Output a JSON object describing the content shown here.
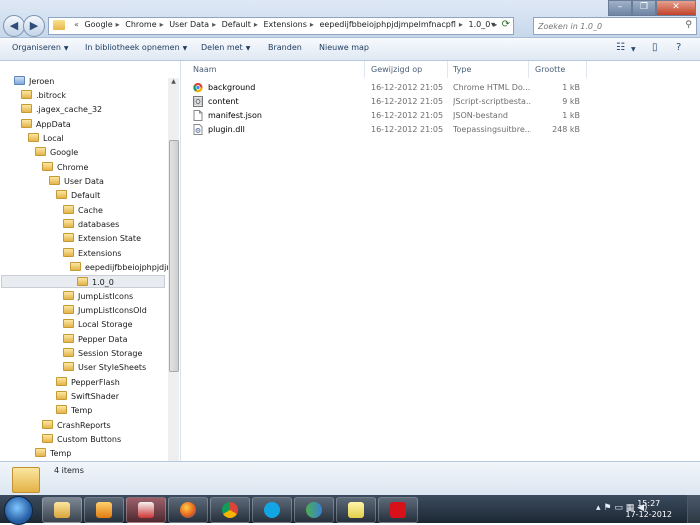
{
  "address": {
    "crumbs": [
      "Google",
      "Chrome",
      "User Data",
      "Default",
      "Extensions",
      "eepedijfbbeiojphpjdjmpelmfnacpfl",
      "1.0_0"
    ]
  },
  "search": {
    "placeholder": "Zoeken in 1.0_0"
  },
  "toolbar": {
    "organize": "Organiseren",
    "include_library": "In bibliotheek opnemen",
    "share": "Delen met",
    "burn": "Branden",
    "new_folder": "Nieuwe map"
  },
  "tree": [
    "Jeroen",
    ".bitrock",
    ".jagex_cache_32",
    "AppData",
    "Local",
    "Google",
    "Chrome",
    "User Data",
    "Default",
    "Cache",
    "databases",
    "Extension State",
    "Extensions",
    "eepedijfbbeiojphpjdjmp",
    "1.0_0",
    "JumpListIcons",
    "JumpListIconsOld",
    "Local Storage",
    "Pepper Data",
    "Session Storage",
    "User StyleSheets",
    "PepperFlash",
    "SwiftShader",
    "Temp",
    "CrashReports",
    "Custom Buttons",
    "Temp"
  ],
  "columns": {
    "name": "Naam",
    "modified": "Gewijzigd op",
    "type": "Type",
    "size": "Grootte"
  },
  "files": [
    {
      "name": "background",
      "modified": "16-12-2012 21:05",
      "type": "Chrome HTML Do...",
      "size": "1 kB",
      "icon": "chrome-html-icon"
    },
    {
      "name": "content",
      "modified": "16-12-2012 21:05",
      "type": "JScript-scriptbesta...",
      "size": "9 kB",
      "icon": "jscript-icon"
    },
    {
      "name": "manifest.json",
      "modified": "16-12-2012 21:05",
      "type": "JSON-bestand",
      "size": "1 kB",
      "icon": "document-icon"
    },
    {
      "name": "plugin.dll",
      "modified": "16-12-2012 21:05",
      "type": "Toepassingsuitbre...",
      "size": "248 kB",
      "icon": "dll-icon"
    }
  ],
  "details": {
    "count": "4 items"
  },
  "taskbar": {
    "time": "15:27",
    "date": "17-12-2012"
  },
  "colors": {
    "selection": "#e8ebef",
    "accent": "#2a62a8"
  }
}
